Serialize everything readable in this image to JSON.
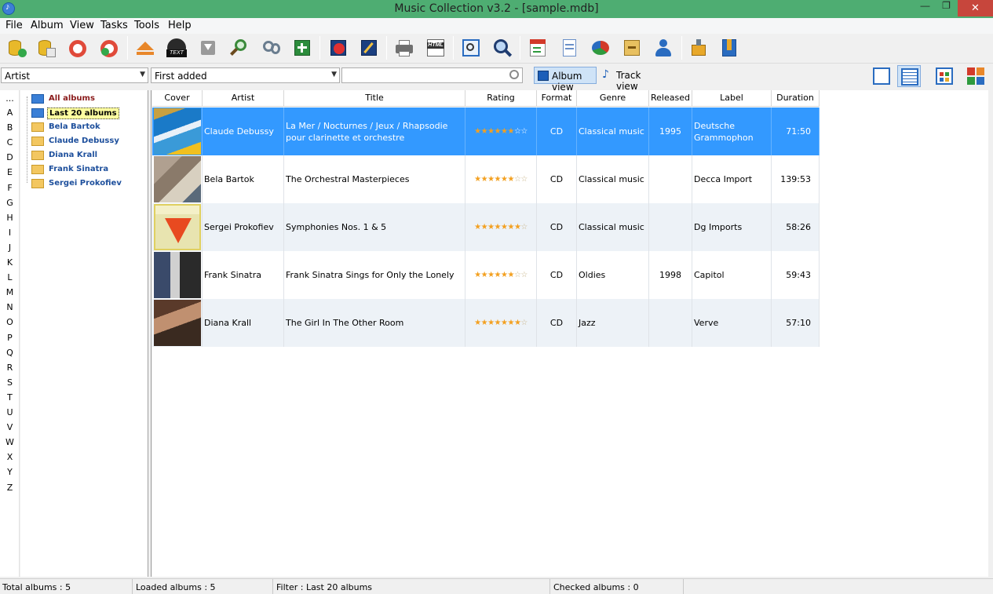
{
  "window": {
    "title": "Music Collection v3.2 - [sample.mdb]",
    "min_glyph": "—",
    "max_glyph": "❐",
    "close_glyph": "✕"
  },
  "menu": [
    "File",
    "Album",
    "View",
    "Tasks",
    "Tools",
    "Help"
  ],
  "toolbar": {
    "icons": [
      "add-album-icon",
      "add-from-database-icon",
      "lifebuoy-icon",
      "lifebuoy-add-icon",
      "eject-icon",
      "cd-text-icon",
      "download-icon",
      "search-add-icon",
      "search-icon",
      "new-item-icon",
      "remove-icon",
      "edit-icon",
      "print-icon",
      "html-export-icon",
      "preview-icon",
      "music-search-icon",
      "calendar-icon",
      "document-icon",
      "pie-chart-icon",
      "cabinet-icon",
      "user-icon",
      "plugin-icon",
      "bookmark-icon"
    ],
    "html_label": "HTML",
    "text_label": "TEXT"
  },
  "filters": {
    "group_by": "Artist",
    "sort_by": "First added",
    "search_value": "",
    "album_view_label": "Album view",
    "track_view_label": "Track view"
  },
  "alphabet": [
    "...",
    "A",
    "B",
    "C",
    "D",
    "E",
    "F",
    "G",
    "H",
    "I",
    "J",
    "K",
    "L",
    "M",
    "N",
    "O",
    "P",
    "Q",
    "R",
    "S",
    "T",
    "U",
    "V",
    "W",
    "X",
    "Y",
    "Z"
  ],
  "tree": {
    "all_albums": "All albums",
    "last_20": "Last 20 albums",
    "artists": [
      "Bela Bartok",
      "Claude Debussy",
      "Diana Krall",
      "Frank Sinatra",
      "Sergei Prokofiev"
    ]
  },
  "columns": [
    "Cover",
    "Artist",
    "Title",
    "Rating",
    "Format",
    "Genre",
    "Released",
    "Label",
    "Duration"
  ],
  "albums": [
    {
      "artist": "Claude Debussy",
      "title": "La Mer / Nocturnes / Jeux / Rhapsodie pour clarinette et orchestre",
      "rating": 6,
      "format": "CD",
      "genre": "Classical music",
      "released": "1995",
      "label": "Deutsche Grammophon",
      "duration": "71:50"
    },
    {
      "artist": "Bela Bartok",
      "title": "The Orchestral Masterpieces",
      "rating": 6,
      "format": "CD",
      "genre": "Classical music",
      "released": "",
      "label": "Decca Import",
      "duration": "139:53"
    },
    {
      "artist": "Sergei Prokofiev",
      "title": "Symphonies Nos. 1 & 5",
      "rating": 7,
      "format": "CD",
      "genre": "Classical music",
      "released": "",
      "label": "Dg Imports",
      "duration": "58:26"
    },
    {
      "artist": "Frank Sinatra",
      "title": "Frank Sinatra Sings for Only the Lonely",
      "rating": 6,
      "format": "CD",
      "genre": "Oldies",
      "released": "1998",
      "label": "Capitol",
      "duration": "59:43"
    },
    {
      "artist": "Diana Krall",
      "title": "The Girl In The Other Room",
      "rating": 7,
      "format": "CD",
      "genre": "Jazz",
      "released": "",
      "label": "Verve",
      "duration": "57:10"
    }
  ],
  "rating_max": 8,
  "status": {
    "total": "Total albums : 5",
    "loaded": "Loaded albums : 5",
    "filter": "Filter : Last 20 albums",
    "checked": "Checked albums : 0"
  },
  "colors": {
    "titlebar": "#4ead72",
    "selection": "#3399ff",
    "close": "#c7463c"
  }
}
